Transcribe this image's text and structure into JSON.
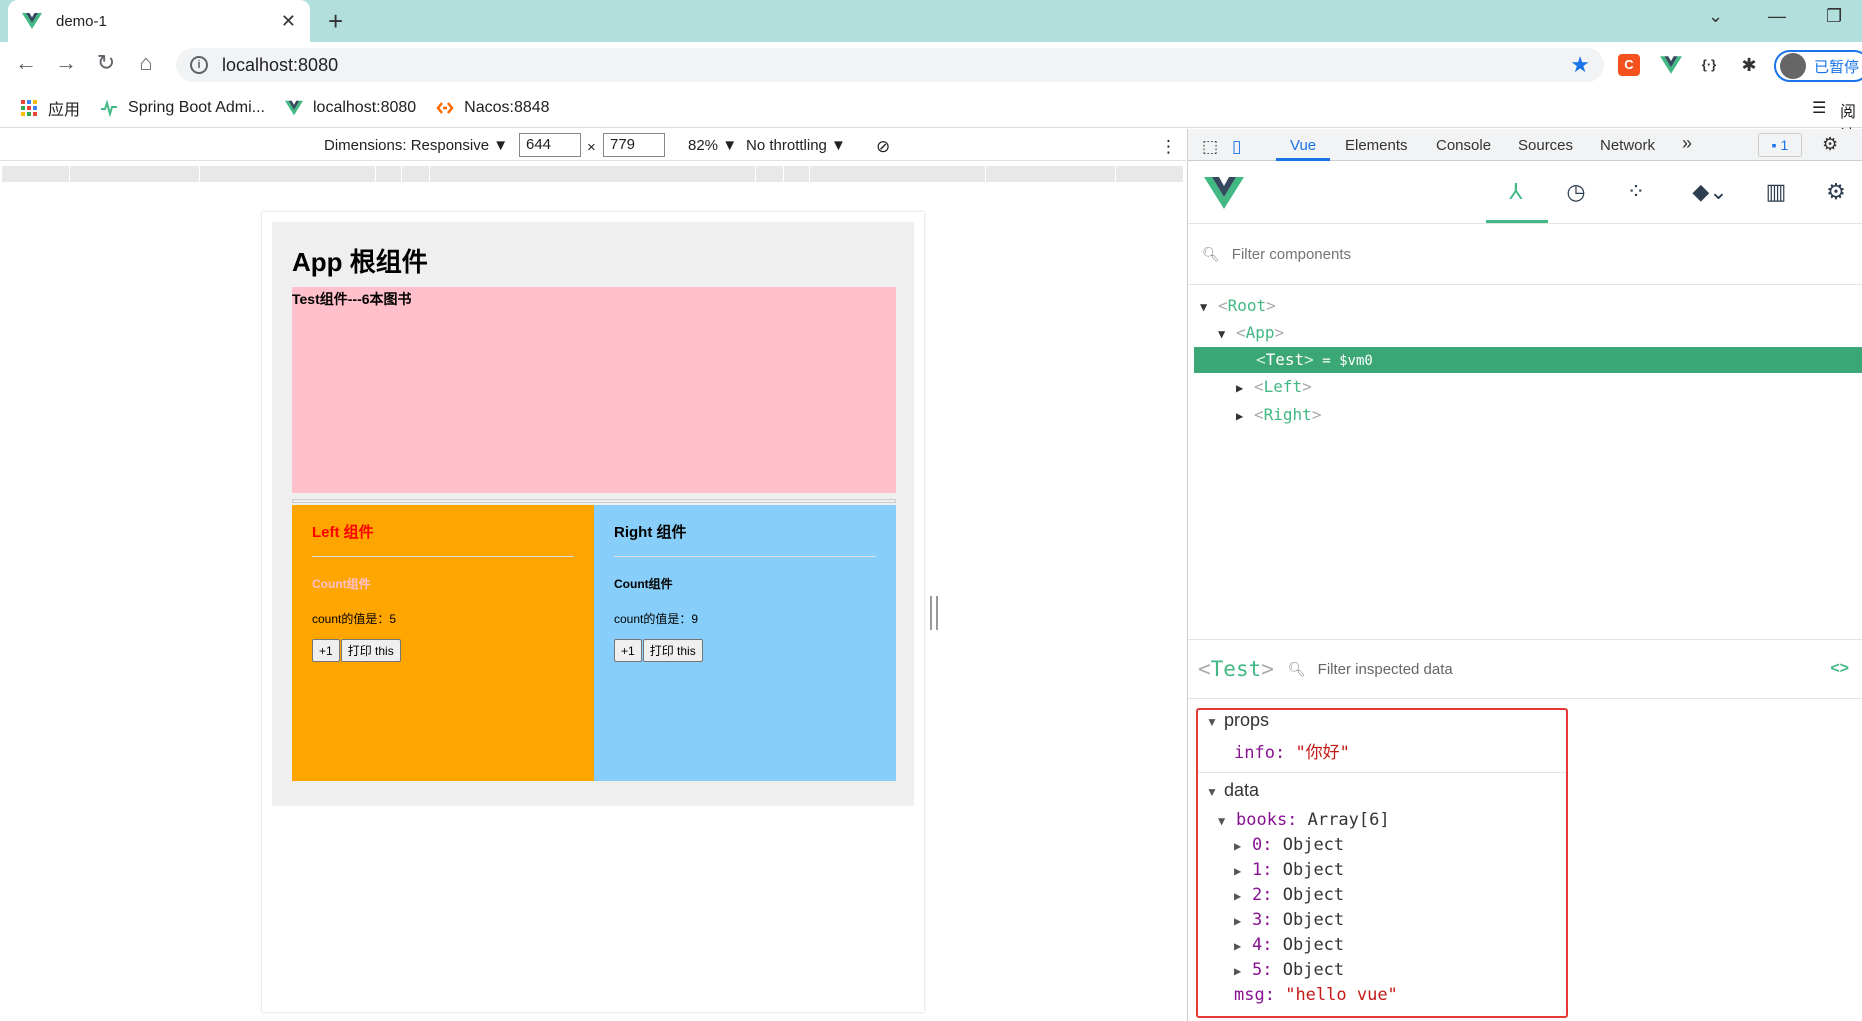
{
  "browser": {
    "tab_title": "demo-1",
    "url": "localhost:8080",
    "profile_label": "已暂停",
    "reading_label": "阅读"
  },
  "bookmarks": [
    {
      "label": "应用"
    },
    {
      "label": "Spring Boot Admi..."
    },
    {
      "label": "localhost:8080"
    },
    {
      "label": "Nacos:8848"
    }
  ],
  "device_toolbar": {
    "dimensions_label": "Dimensions: Responsive ▼",
    "width": "644",
    "times": "×",
    "height": "779",
    "zoom": "82% ▼",
    "throttling": "No throttling ▼"
  },
  "page": {
    "app_title": "App 根组件",
    "test_title": "Test组件---6本图书",
    "left": {
      "title": "Left 组件",
      "count_title": "Count组件",
      "count_text": "count的值是：5",
      "inc_label": "+1",
      "print_label": "打印 this"
    },
    "right": {
      "title": "Right 组件",
      "count_title": "Count组件",
      "count_text": "count的值是：9",
      "inc_label": "+1",
      "print_label": "打印 this"
    }
  },
  "devtools": {
    "tabs": [
      "Vue",
      "Elements",
      "Console",
      "Sources",
      "Network"
    ],
    "more": "»",
    "issues_count": "1",
    "filter_components_placeholder": "Filter components",
    "tree": {
      "root": "Root",
      "app": "App",
      "test": "Test",
      "test_suffix": " = $vm0",
      "left": "Left",
      "right": "Right"
    },
    "inspect": {
      "component": "Test",
      "filter_placeholder": "Filter inspected data",
      "code_icon": "<>"
    },
    "state": {
      "props_label": "props",
      "info_key": "info:",
      "info_value": "\"你好\"",
      "data_label": "data",
      "books_key": "books:",
      "books_type": "Array[6]",
      "items": [
        {
          "idx": "0:",
          "type": "Object"
        },
        {
          "idx": "1:",
          "type": "Object"
        },
        {
          "idx": "2:",
          "type": "Object"
        },
        {
          "idx": "3:",
          "type": "Object"
        },
        {
          "idx": "4:",
          "type": "Object"
        },
        {
          "idx": "5:",
          "type": "Object"
        }
      ],
      "msg_key": "msg:",
      "msg_value": "\"hello vue\""
    }
  },
  "colors": {
    "vue_green": "#42b883",
    "selected_row": "#3ba776",
    "pink": "#ffc0cb",
    "orange": "#ffa500",
    "lightblue": "#87cefa",
    "highlight_border": "#e53935"
  }
}
